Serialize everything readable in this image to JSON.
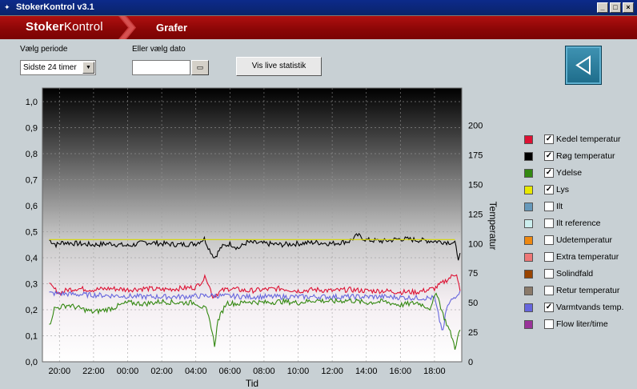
{
  "window": {
    "title": "StokerKontrol v3.1",
    "minimize": "_",
    "maximize": "□",
    "close": "×"
  },
  "header": {
    "brand_bold": "Stoker",
    "brand_light": "Kontrol",
    "section": "Grafer"
  },
  "controls": {
    "period_label": "Vælg periode",
    "period_value": "Sidste 24 timer",
    "date_label": "Eller vælg dato",
    "date_value": "",
    "live_button": "Vis live statistik"
  },
  "chart_data": {
    "type": "line",
    "xlabel": "Tid",
    "ylabel_left": "",
    "ylabel_right": "Temperatur",
    "x_ticks": [
      "20:00",
      "22:00",
      "00:00",
      "02:00",
      "04:00",
      "06:00",
      "08:00",
      "10:00",
      "12:00",
      "14:00",
      "16:00",
      "18:00"
    ],
    "x_hours": [
      19.0,
      20,
      22,
      24,
      26,
      28,
      30,
      32,
      34,
      36,
      38,
      40,
      42,
      43.6
    ],
    "xlim": [
      19.0,
      43.6
    ],
    "ylim_left": [
      0,
      1.0
    ],
    "ylim_right": [
      0,
      220
    ],
    "left_ticks": [
      "0,0",
      "0,1",
      "0,2",
      "0,3",
      "0,4",
      "0,5",
      "0,6",
      "0,7",
      "0,8",
      "0,9",
      "1,0"
    ],
    "right_ticks": [
      "0",
      "25",
      "50",
      "75",
      "100",
      "125",
      "150",
      "175",
      "200"
    ],
    "series": [
      {
        "name": "Røg temperatur",
        "axis": "right",
        "color": "#000000",
        "points": [
          [
            19.4,
            103
          ],
          [
            19.8,
            99
          ],
          [
            20.2,
            101
          ],
          [
            21,
            100
          ],
          [
            22,
            99
          ],
          [
            23,
            100
          ],
          [
            24,
            98
          ],
          [
            25,
            101
          ],
          [
            26,
            100
          ],
          [
            27,
            99
          ],
          [
            28,
            100
          ],
          [
            28.5,
            104
          ],
          [
            28.8,
            95
          ],
          [
            29.1,
            88
          ],
          [
            29.5,
            97
          ],
          [
            30,
            100
          ],
          [
            30.5,
            96
          ],
          [
            31,
            101
          ],
          [
            32,
            100
          ],
          [
            33,
            99
          ],
          [
            34,
            100
          ],
          [
            35,
            101
          ],
          [
            36,
            100
          ],
          [
            37,
            102
          ],
          [
            37.5,
            107
          ],
          [
            38,
            103
          ],
          [
            39,
            102
          ],
          [
            40,
            104
          ],
          [
            41,
            103
          ],
          [
            42,
            102
          ],
          [
            43,
            101
          ],
          [
            43.2,
            100
          ],
          [
            43.4,
            88
          ],
          [
            43.5,
            92
          ]
        ]
      },
      {
        "name": "Lys",
        "axis": "left",
        "color": "#d8d800",
        "points": [
          [
            19.4,
            0.47
          ],
          [
            43.2,
            0.47
          ]
        ]
      },
      {
        "name": "Kedel temperatur",
        "axis": "right",
        "color": "#dd1133",
        "points": [
          [
            19.4,
            65
          ],
          [
            20,
            58
          ],
          [
            20.5,
            61
          ],
          [
            21,
            62
          ],
          [
            22,
            61
          ],
          [
            23,
            62
          ],
          [
            24,
            61
          ],
          [
            25,
            62
          ],
          [
            26,
            61
          ],
          [
            27,
            62
          ],
          [
            28,
            63
          ],
          [
            28.6,
            72
          ],
          [
            29,
            55
          ],
          [
            29.5,
            60
          ],
          [
            30,
            62
          ],
          [
            31,
            60
          ],
          [
            32,
            61
          ],
          [
            33,
            62
          ],
          [
            34,
            60
          ],
          [
            35,
            61
          ],
          [
            36,
            60
          ],
          [
            37,
            61
          ],
          [
            38,
            60
          ],
          [
            39,
            60
          ],
          [
            40,
            59
          ],
          [
            41,
            59
          ],
          [
            42,
            62
          ],
          [
            43,
            72
          ],
          [
            43.3,
            75
          ],
          [
            43.5,
            60
          ]
        ]
      },
      {
        "name": "Varmtvands temp.",
        "axis": "right",
        "color": "#6666dd",
        "points": [
          [
            19.4,
            58
          ],
          [
            21,
            57
          ],
          [
            23,
            56
          ],
          [
            25,
            55
          ],
          [
            27,
            55
          ],
          [
            29,
            56
          ],
          [
            31,
            55
          ],
          [
            33,
            55
          ],
          [
            35,
            55
          ],
          [
            37,
            55
          ],
          [
            39,
            55
          ],
          [
            41,
            54
          ],
          [
            42.0,
            54
          ],
          [
            42.3,
            35
          ],
          [
            42.5,
            25
          ],
          [
            42.7,
            45
          ],
          [
            43,
            52
          ],
          [
            43.5,
            60
          ]
        ]
      },
      {
        "name": "Ydelse",
        "axis": "right",
        "color": "#338811",
        "points": [
          [
            19.4,
            30
          ],
          [
            19.7,
            45
          ],
          [
            20.5,
            48
          ],
          [
            21,
            46
          ],
          [
            22,
            42
          ],
          [
            23,
            45
          ],
          [
            24,
            50
          ],
          [
            25,
            49
          ],
          [
            26,
            51
          ],
          [
            27,
            50
          ],
          [
            28,
            50
          ],
          [
            28.6,
            44
          ],
          [
            28.9,
            30
          ],
          [
            29.1,
            14
          ],
          [
            29.3,
            35
          ],
          [
            29.8,
            50
          ],
          [
            30.5,
            49
          ],
          [
            31,
            51
          ],
          [
            32,
            50
          ],
          [
            33,
            51
          ],
          [
            34,
            50
          ],
          [
            35,
            52
          ],
          [
            36,
            51
          ],
          [
            37,
            52
          ],
          [
            38,
            50
          ],
          [
            39,
            51
          ],
          [
            40,
            48
          ],
          [
            41,
            50
          ],
          [
            41.8,
            45
          ],
          [
            42.1,
            60
          ],
          [
            42.5,
            40
          ],
          [
            43,
            22
          ],
          [
            43.2,
            12
          ],
          [
            43.5,
            27
          ]
        ]
      }
    ]
  },
  "legend": [
    {
      "label": "Kedel temperatur",
      "color": "#dd1133",
      "checked": true
    },
    {
      "label": "Røg temperatur",
      "color": "#000000",
      "checked": true
    },
    {
      "label": "Ydelse",
      "color": "#338811",
      "checked": true
    },
    {
      "label": "Lys",
      "color": "#e8e800",
      "checked": true
    },
    {
      "label": "Ilt",
      "color": "#6699bb",
      "checked": false
    },
    {
      "label": "Ilt reference",
      "color": "#cceeee",
      "checked": false
    },
    {
      "label": "Udetemperatur",
      "color": "#ee8811",
      "checked": false
    },
    {
      "label": "Extra temperatur",
      "color": "#ee7777",
      "checked": false
    },
    {
      "label": "Solindfald",
      "color": "#994400",
      "checked": false
    },
    {
      "label": "Retur temperatur",
      "color": "#8a7a6a",
      "checked": false
    },
    {
      "label": "Varmtvands temp.",
      "color": "#6666dd",
      "checked": true
    },
    {
      "label": "Flow liter/time",
      "color": "#993399",
      "checked": false
    }
  ]
}
